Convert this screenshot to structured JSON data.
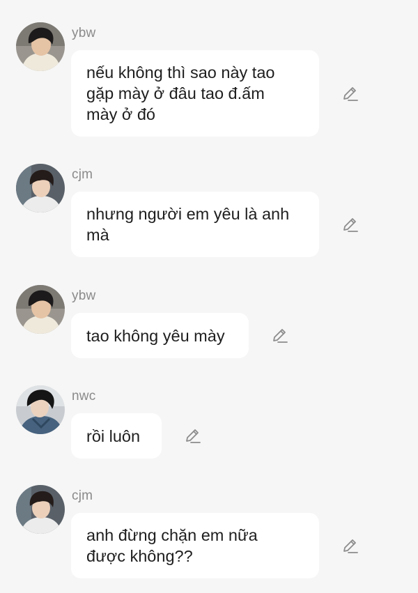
{
  "messages": [
    {
      "sender": "ybw",
      "avatar_icon": "avatar-ybw-icon",
      "text": "nếu không thì sao này tao\ngặp mày ở đâu tao đ.ấm\nmày ở đó",
      "edit_icon": "pencil-icon"
    },
    {
      "sender": "cjm",
      "avatar_icon": "avatar-cjm-icon",
      "text": "nhưng người em yêu là anh\nmà",
      "edit_icon": "pencil-icon"
    },
    {
      "sender": "ybw",
      "avatar_icon": "avatar-ybw-icon",
      "text": "tao không yêu mày",
      "edit_icon": "pencil-icon"
    },
    {
      "sender": "nwc",
      "avatar_icon": "avatar-nwc-icon",
      "text": "rồi luôn",
      "edit_icon": "pencil-icon"
    },
    {
      "sender": "cjm",
      "avatar_icon": "avatar-cjm-icon",
      "text": "anh đừng chặn em nữa\nđược không??",
      "edit_icon": "pencil-icon"
    }
  ],
  "colors": {
    "background": "#f6f6f6",
    "bubble": "#ffffff",
    "sender_text": "#8a8a8a",
    "message_text": "#1e1e1e",
    "edit_icon": "#8c8c8c"
  }
}
